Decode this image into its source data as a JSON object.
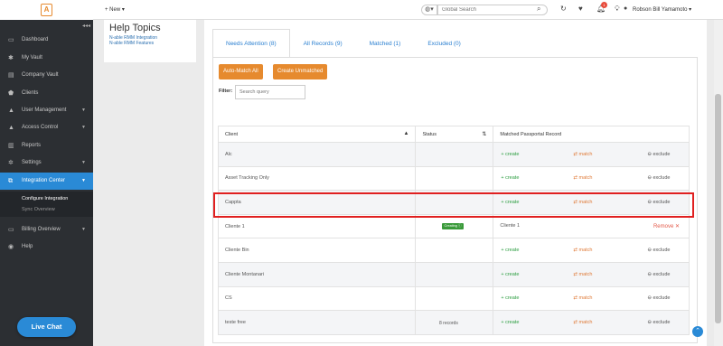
{
  "topbar": {
    "logo_text": "A",
    "new_label": "+ New ▾",
    "search_placeholder": "Global Search",
    "user_name": "Robson Bill Yamamoto ▾",
    "notification_count": "1"
  },
  "sidebar": {
    "items": [
      {
        "label": "Dashboard",
        "icon": "▭"
      },
      {
        "label": "My Vault",
        "icon": "✱"
      },
      {
        "label": "Company Vault",
        "icon": "▤"
      },
      {
        "label": "Clients",
        "icon": "⬟"
      },
      {
        "label": "User Management",
        "icon": "▲"
      },
      {
        "label": "Access Control",
        "icon": "▲"
      },
      {
        "label": "Reports",
        "icon": "▥"
      },
      {
        "label": "Settings",
        "icon": "✲"
      },
      {
        "label": "Integration Center",
        "icon": "⧉"
      },
      {
        "label": "Billing Overview",
        "icon": "▭"
      },
      {
        "label": "Help",
        "icon": "◉"
      }
    ],
    "sub_items": [
      "Configure Integration",
      "Sync Overview"
    ],
    "live_chat": "Live Chat"
  },
  "help": {
    "title": "Help Topics",
    "links": [
      "N-able RMM Integration",
      "N-able RMM Features"
    ]
  },
  "tabs": [
    "Needs Attention (8)",
    "All Records (9)",
    "Matched (1)",
    "Excluded (0)"
  ],
  "buttons": {
    "auto_match": "Auto-Match All",
    "create_unmatched": "Create Unmatched"
  },
  "filter": {
    "label": "Filter:",
    "placeholder": "Search query"
  },
  "table": {
    "headers": [
      "Client",
      "Status",
      "Matched Passportal Record"
    ],
    "actions": {
      "create": "+ create",
      "match": "⇄ match",
      "exclude": "⊖ exclude"
    },
    "rows": [
      {
        "client": "Alc",
        "status": "",
        "matched": ""
      },
      {
        "client": "Asset Tracking Only",
        "status": "",
        "matched": ""
      },
      {
        "client": "Cappta",
        "status": "",
        "matched": ""
      },
      {
        "client": "Cliente 1",
        "status": "Creating ⓘ",
        "matched": "Cliente 1",
        "remove": "Remove ✕"
      },
      {
        "client": "Cliente Bin",
        "status": "",
        "matched": ""
      },
      {
        "client": "Cliente Montanari",
        "status": "",
        "matched": ""
      },
      {
        "client": "CS",
        "status": "",
        "matched": ""
      },
      {
        "client": "teste free",
        "status": "",
        "matched": ""
      }
    ],
    "footer": "8 records"
  },
  "colors": {
    "accent": "#2a8ad6",
    "orange": "#e68a2e",
    "sidebar": "#2c2f33",
    "create": "#2a9d3f",
    "highlight": "#e02020"
  }
}
